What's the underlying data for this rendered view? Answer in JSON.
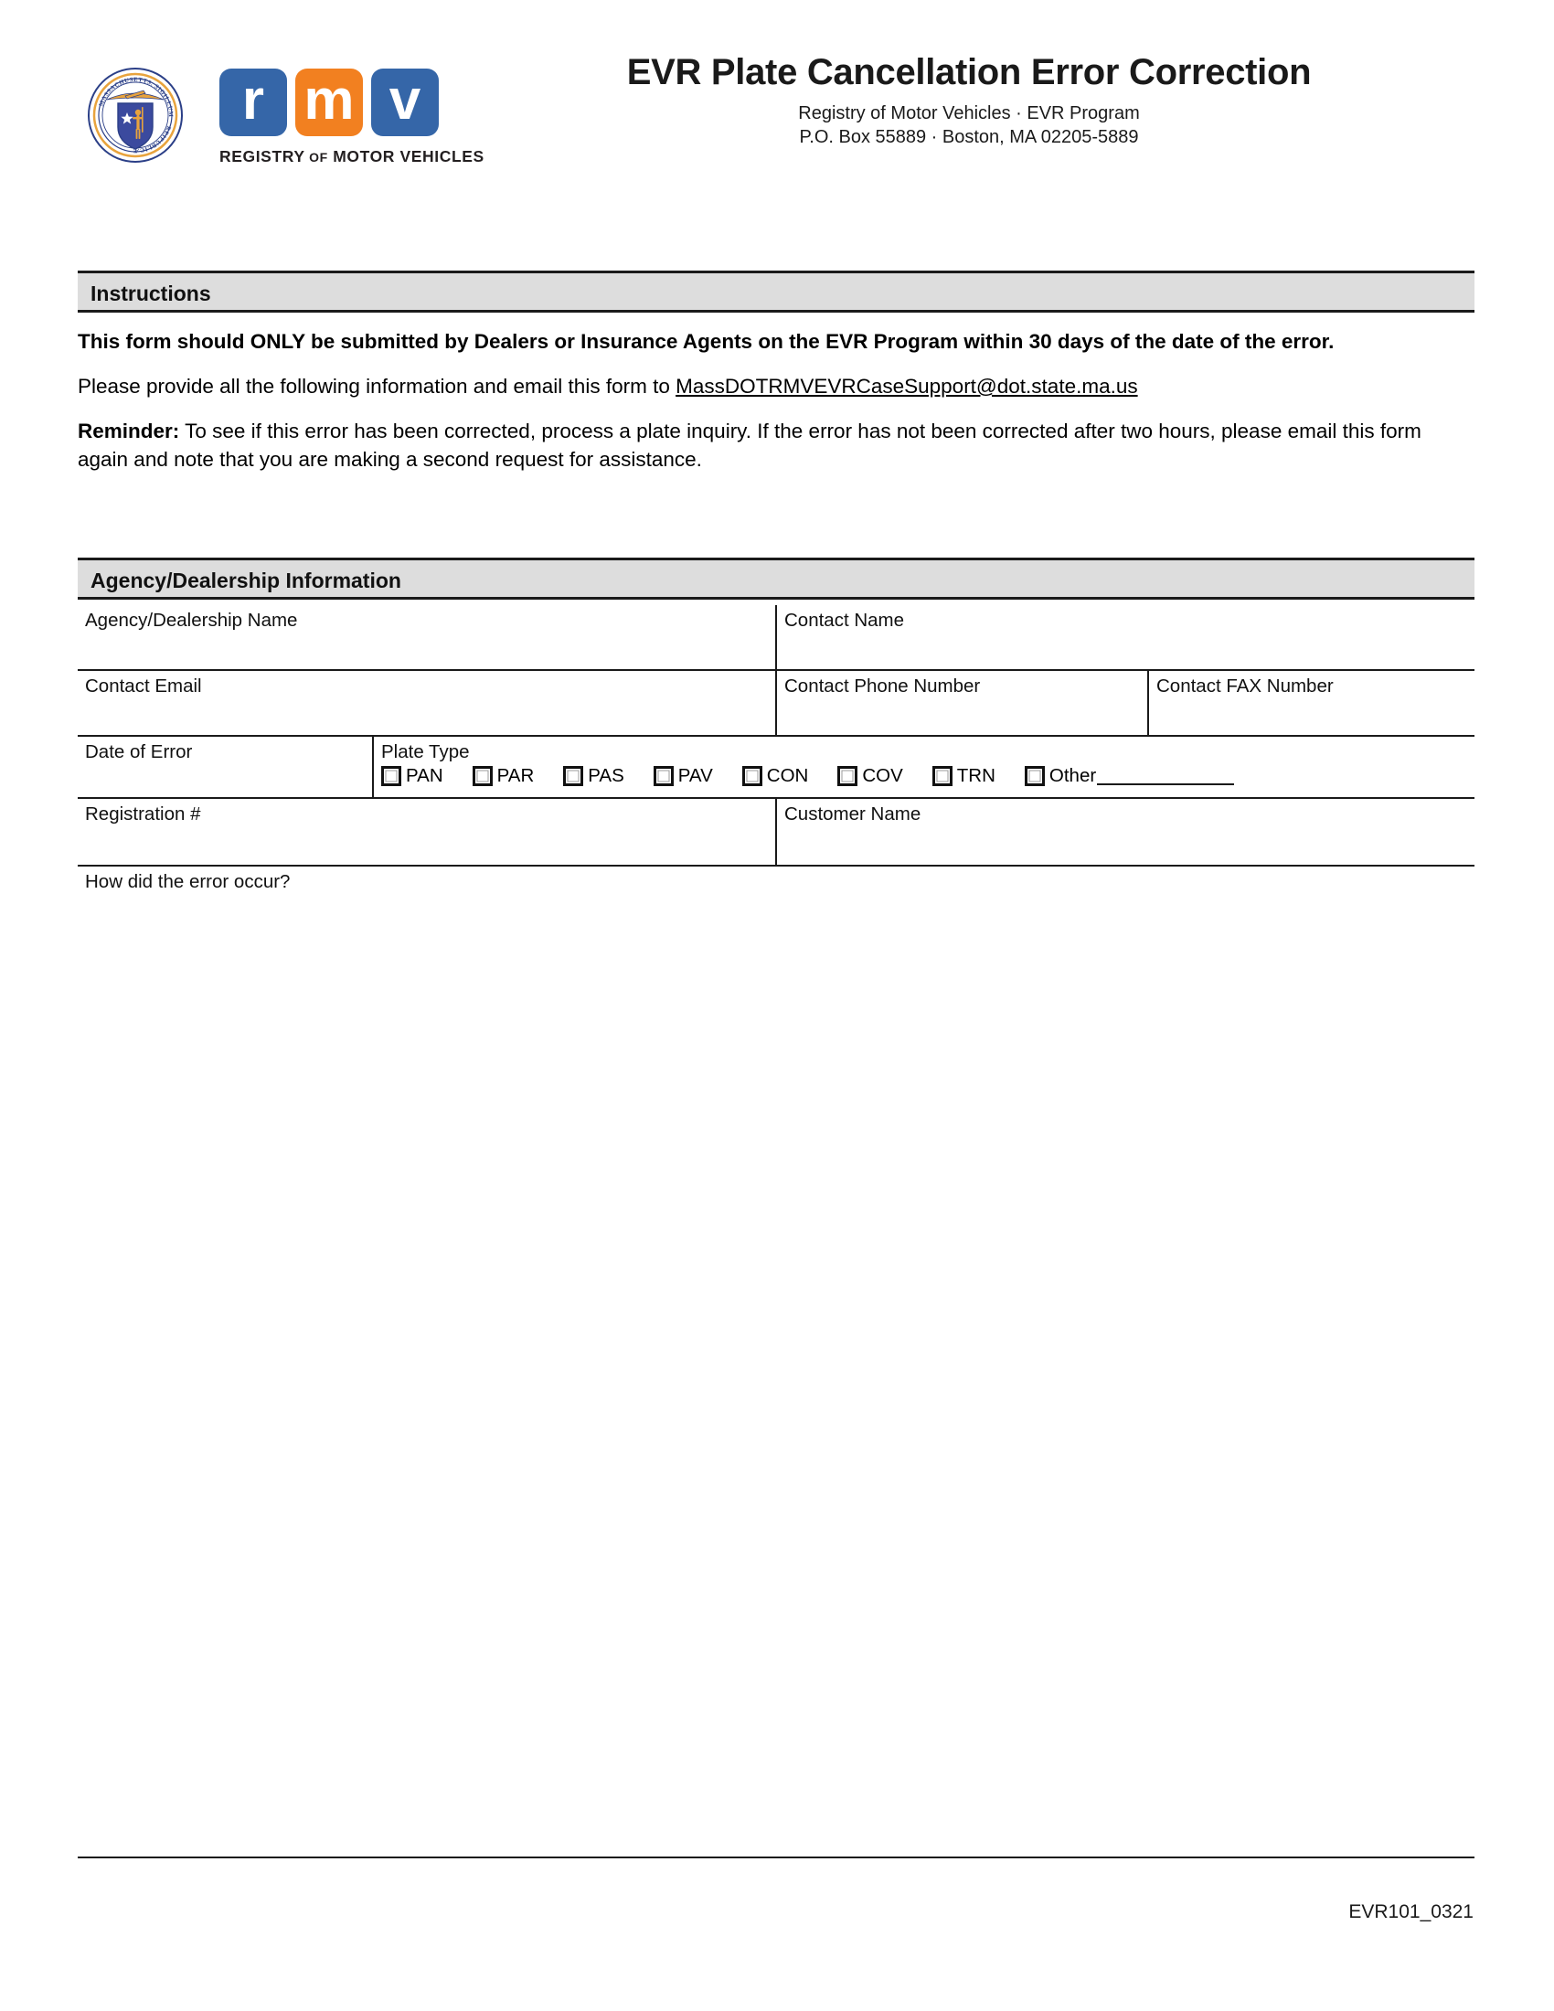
{
  "header": {
    "title": "EVR Plate Cancellation Error Correction",
    "subtitle_line1": "Registry of Motor Vehicles · EVR Program",
    "subtitle_line2": "P.O. Box 55889 · Boston, MA 02205-5889",
    "seal_icon": "massachusetts-state-seal-icon",
    "logo": {
      "letters": [
        "r",
        "m",
        "v"
      ],
      "colors": [
        "#3566a8",
        "#f28020",
        "#3566a8"
      ],
      "caption_registry": "REGISTRY",
      "caption_of": "OF",
      "caption_motor_vehicles": "MOTOR VEHICLES"
    }
  },
  "instructions": {
    "section_title": "Instructions",
    "bold_paragraph": "This form should ONLY be submitted by Dealers or Insurance Agents on the EVR Program within 30 days of the date of the error.",
    "email_intro": "Please provide all the following information and email this form to ",
    "email_address": "MassDOTRMVEVRCaseSupport@dot.state.ma.us",
    "reminder_lead": "Reminder:",
    "reminder_text": " To see if this error has been corrected, process a plate inquiry. If the error has not been corrected after two hours, please email this form again and note that you are making a second request for assistance."
  },
  "agency_section": {
    "section_title": "Agency/Dealership Information",
    "fields": {
      "agency_name": "Agency/Dealership Name",
      "contact_name": "Contact Name",
      "contact_email": "Contact Email",
      "contact_phone": "Contact Phone Number",
      "contact_fax": "Contact FAX Number",
      "date_of_error": "Date of Error",
      "plate_type": "Plate Type",
      "registration_number": "Registration #",
      "customer_name": "Customer Name",
      "how_did_error_occur": "How did the error occur?"
    },
    "plate_types": [
      {
        "code": "PAN",
        "checked": false
      },
      {
        "code": "PAR",
        "checked": false
      },
      {
        "code": "PAS",
        "checked": false
      },
      {
        "code": "PAV",
        "checked": false
      },
      {
        "code": "CON",
        "checked": false
      },
      {
        "code": "COV",
        "checked": false
      },
      {
        "code": "TRN",
        "checked": false
      },
      {
        "code": "Other",
        "checked": false
      }
    ]
  },
  "footer": {
    "form_code": "EVR101_0321"
  },
  "colors": {
    "section_bar_bg": "#dddddd",
    "rule": "#1a1a1a",
    "rmv_blue": "#3566a8",
    "rmv_orange": "#f28020"
  }
}
